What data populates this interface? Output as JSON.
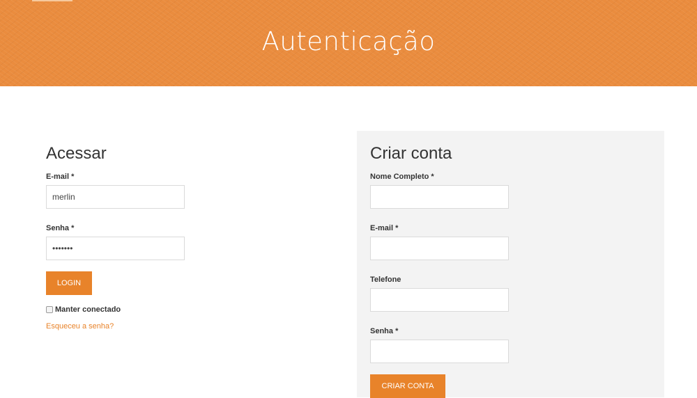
{
  "header": {
    "title": "Autenticação"
  },
  "login": {
    "title": "Acessar",
    "email_label": "E-mail",
    "email_value": "merlin",
    "password_label": "Senha",
    "password_value": "•••••••",
    "required_mark": "*",
    "login_button": "LOGIN",
    "remember_label": "Manter conectado",
    "forgot_link": "Esqueceu a senha?"
  },
  "register": {
    "title": "Criar conta",
    "fields": [
      {
        "label": "Nome Completo",
        "required": "*",
        "value": ""
      },
      {
        "label": "E-mail",
        "required": "*",
        "value": ""
      },
      {
        "label": "Telefone",
        "required": "",
        "value": ""
      },
      {
        "label": "Senha",
        "required": "*",
        "value": ""
      }
    ],
    "submit_button": "CRIAR CONTA"
  },
  "colors": {
    "accent": "#e8832a",
    "banner": "#ea8c3e",
    "panel_bg": "#f3f3f3"
  }
}
